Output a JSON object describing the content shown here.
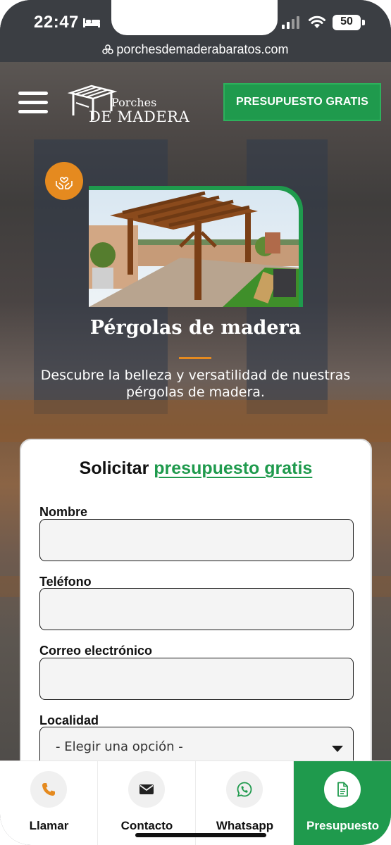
{
  "status_bar": {
    "time": "22:47",
    "battery": "50",
    "icons": [
      "bed-icon",
      "signal-icon",
      "wifi-icon",
      "battery-icon"
    ]
  },
  "browser": {
    "url": "porchesdemaderabaratos.com"
  },
  "header": {
    "menu_icon": "hamburger-menu-icon",
    "logo_top": "Porches",
    "logo_bottom": "DE MADERA",
    "cta_label": "PRESUPUESTO GRATIS"
  },
  "hero": {
    "badge_icon": "hands-heart-icon",
    "title": "Pérgolas de madera",
    "subtitle": "Descubre la belleza y versatilidad de nuestras pérgolas de madera."
  },
  "form": {
    "title_plain": "Solicitar ",
    "title_accent": "presupuesto gratis",
    "fields": [
      {
        "label": "Nombre",
        "value": ""
      },
      {
        "label": "Teléfono",
        "value": ""
      },
      {
        "label": "Correo electrónico",
        "value": ""
      },
      {
        "label": "Localidad",
        "selected": "- Elegir una opción -"
      }
    ]
  },
  "bottom_nav": {
    "items": [
      {
        "label": "Llamar",
        "icon": "phone-icon"
      },
      {
        "label": "Contacto",
        "icon": "envelope-icon"
      },
      {
        "label": "Whatsapp",
        "icon": "whatsapp-icon"
      },
      {
        "label": "Presupuesto",
        "icon": "document-icon",
        "active": true
      }
    ]
  },
  "colors": {
    "brand_green": "#1f9a4d",
    "accent_orange": "#e58a1f",
    "status_bar": "#3b3e43"
  }
}
